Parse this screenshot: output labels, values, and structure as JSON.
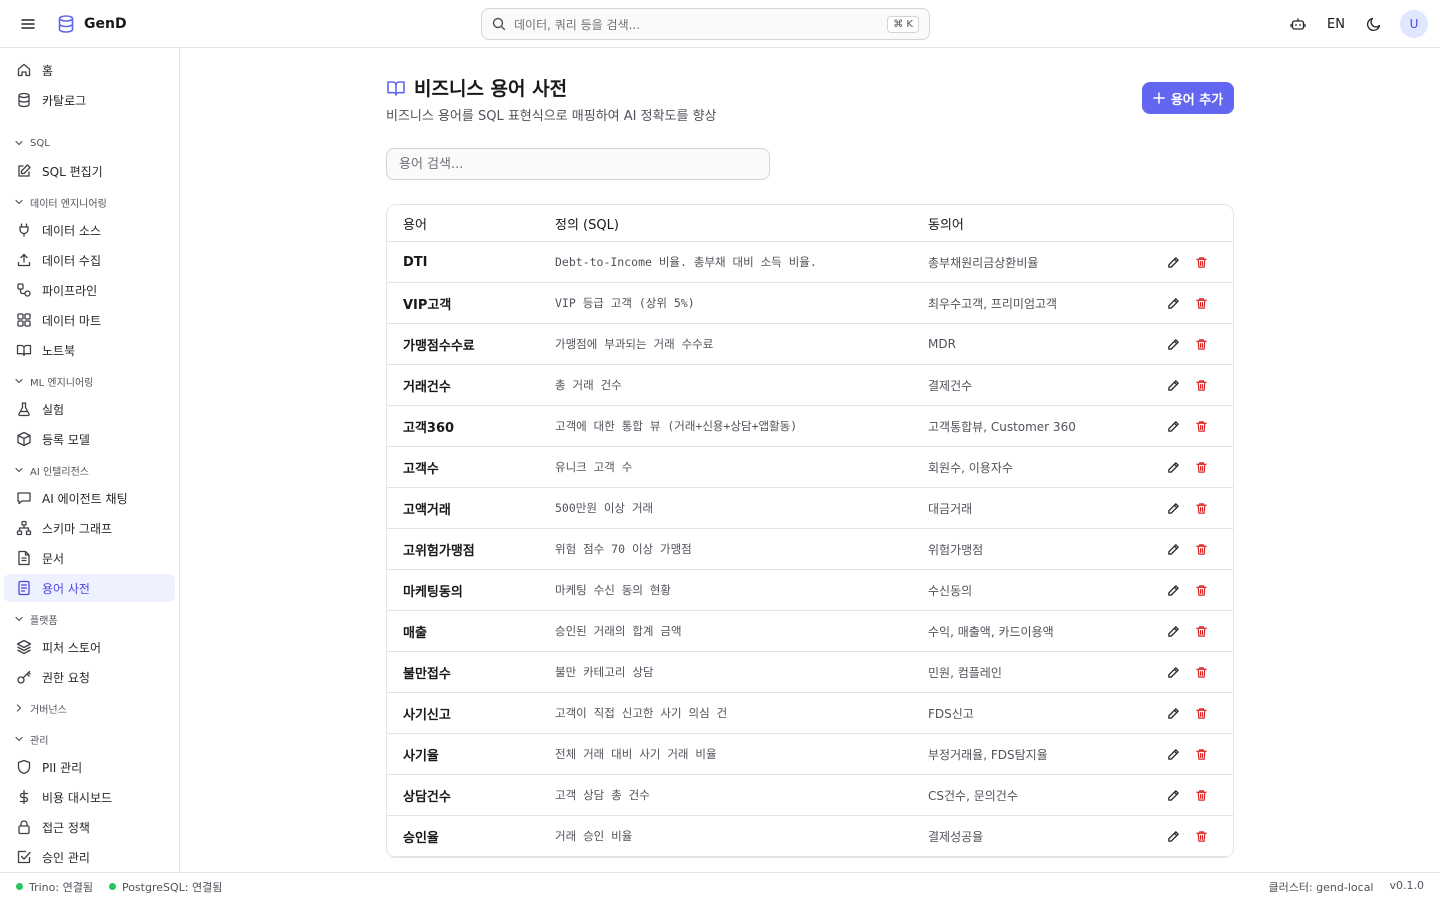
{
  "app": {
    "name": "GenD"
  },
  "header": {
    "search_placeholder": "데이터, 쿼리 등을 검색...",
    "shortcut": "⌘ K",
    "lang": "EN",
    "avatar_initial": "U"
  },
  "sidebar": {
    "top": [
      {
        "label": "홈",
        "icon": "home-icon"
      },
      {
        "label": "카탈로그",
        "icon": "database-icon"
      }
    ],
    "sections": [
      {
        "label": "SQL",
        "expanded": true,
        "items": [
          {
            "label": "SQL 편집기",
            "icon": "edit-icon"
          }
        ]
      },
      {
        "label": "데이터 엔지니어링",
        "expanded": true,
        "items": [
          {
            "label": "데이터 소스",
            "icon": "plug-icon"
          },
          {
            "label": "데이터 수집",
            "icon": "upload-icon"
          },
          {
            "label": "파이프라인",
            "icon": "workflow-icon"
          },
          {
            "label": "데이터 마트",
            "icon": "grid-icon"
          },
          {
            "label": "노트북",
            "icon": "book-open-icon"
          }
        ]
      },
      {
        "label": "ML 엔지니어링",
        "expanded": true,
        "items": [
          {
            "label": "실험",
            "icon": "flask-icon"
          },
          {
            "label": "등록 모델",
            "icon": "package-icon"
          }
        ]
      },
      {
        "label": "AI 인텔리전스",
        "expanded": true,
        "items": [
          {
            "label": "AI 에이전트 채팅",
            "icon": "chat-icon"
          },
          {
            "label": "스키마 그래프",
            "icon": "network-icon"
          },
          {
            "label": "문서",
            "icon": "file-text-icon"
          },
          {
            "label": "용어 사전",
            "icon": "glossary-icon",
            "active": true
          }
        ]
      },
      {
        "label": "플랫폼",
        "expanded": true,
        "items": [
          {
            "label": "피처 스토어",
            "icon": "layers-icon"
          },
          {
            "label": "권한 요청",
            "icon": "key-icon"
          }
        ]
      },
      {
        "label": "거버넌스",
        "expanded": false,
        "items": []
      },
      {
        "label": "관리",
        "expanded": true,
        "items": [
          {
            "label": "PII 관리",
            "icon": "shield-icon"
          },
          {
            "label": "비용 대시보드",
            "icon": "dollar-icon"
          },
          {
            "label": "접근 정책",
            "icon": "lock-icon"
          },
          {
            "label": "승인 관리",
            "icon": "check-square-icon"
          }
        ]
      }
    ]
  },
  "page": {
    "title": "비즈니스 용어 사전",
    "subtitle": "비즈니스 용어를 SQL 표현식으로 매핑하여 AI 정확도를 향상",
    "add_label": "용어 추가",
    "search_placeholder": "용어 검색...",
    "columns": {
      "term": "용어",
      "definition": "정의 (SQL)",
      "synonyms": "동의어"
    },
    "rows": [
      {
        "term": "DTI",
        "definition": "Debt-to-Income 비율. 총부채 대비 소득 비율.",
        "synonyms": "총부채원리금상환비율"
      },
      {
        "term": "VIP고객",
        "definition": "VIP 등급 고객 (상위 5%)",
        "synonyms": "최우수고객, 프리미엄고객"
      },
      {
        "term": "가맹점수수료",
        "definition": "가맹점에 부과되는 거래 수수료",
        "synonyms": "MDR"
      },
      {
        "term": "거래건수",
        "definition": "총 거래 건수",
        "synonyms": "결제건수"
      },
      {
        "term": "고객360",
        "definition": "고객에 대한 통합 뷰 (거래+신용+상담+앱활동)",
        "synonyms": "고객통합뷰, Customer 360"
      },
      {
        "term": "고객수",
        "definition": "유니크 고객 수",
        "synonyms": "회원수, 이용자수"
      },
      {
        "term": "고액거래",
        "definition": "500만원 이상 거래",
        "synonyms": "대금거래"
      },
      {
        "term": "고위험가맹점",
        "definition": "위험 점수 70 이상 가맹점",
        "synonyms": "위험가맹점"
      },
      {
        "term": "마케팅동의",
        "definition": "마케팅 수신 동의 현황",
        "synonyms": "수신동의"
      },
      {
        "term": "매출",
        "definition": "승인된 거래의 합계 금액",
        "synonyms": "수익, 매출액, 카드이용액"
      },
      {
        "term": "불만접수",
        "definition": "불만 카테고리 상담",
        "synonyms": "민원, 컴플레인"
      },
      {
        "term": "사기신고",
        "definition": "고객이 직접 신고한 사기 의심 건",
        "synonyms": "FDS신고"
      },
      {
        "term": "사기율",
        "definition": "전체 거래 대비 사기 거래 비율",
        "synonyms": "부정거래율, FDS탐지율"
      },
      {
        "term": "상담건수",
        "definition": "고객 상담 총 건수",
        "synonyms": "CS건수, 문의건수"
      },
      {
        "term": "승인율",
        "definition": "거래 승인 비율",
        "synonyms": "결제성공율"
      }
    ]
  },
  "status": {
    "trino": "Trino: 연결됨",
    "postgres": "PostgreSQL: 연결됨",
    "cluster": "클러스터: gend-local",
    "version": "v0.1.0"
  },
  "colors": {
    "accent": "#6366f1",
    "delete": "#dc2626",
    "connected": "#22c55e"
  }
}
